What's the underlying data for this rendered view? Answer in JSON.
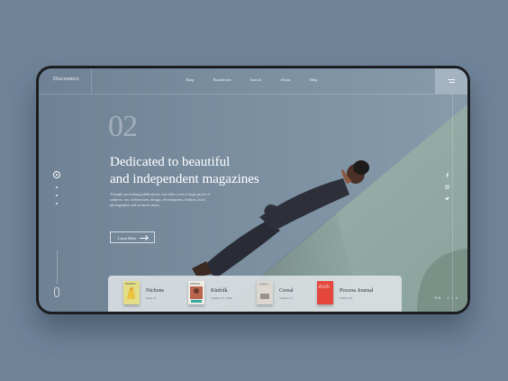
{
  "brand": "Disconnect",
  "nav": {
    "items": [
      "Shop",
      "Businesses",
      "Search",
      "About",
      "Help"
    ]
  },
  "hero": {
    "number": "02",
    "headline_line1": "Dedicated to beautiful",
    "headline_line2": "and independent magazines",
    "description": "Thought provoking publications, our titles cover a large proof of subjects: art, architecture, design, development, fashion, food photography and so much more.",
    "cta": "Learn More"
  },
  "magazines": [
    {
      "title": "Nichons",
      "sub": "Issue 10",
      "cover_color": "#d9d26e"
    },
    {
      "title": "Kinfolk",
      "sub": "Volume 25 · Print",
      "cover_color": "#c9c0b0"
    },
    {
      "title": "Cereal",
      "sub": "Volume 15",
      "cover_color": "#d7d3cc"
    },
    {
      "title": "Process Journal",
      "sub": "Edition 16",
      "cover_color": "#e5463c"
    }
  ],
  "lang": "EN",
  "pager": {
    "current": 1,
    "total": 4
  }
}
